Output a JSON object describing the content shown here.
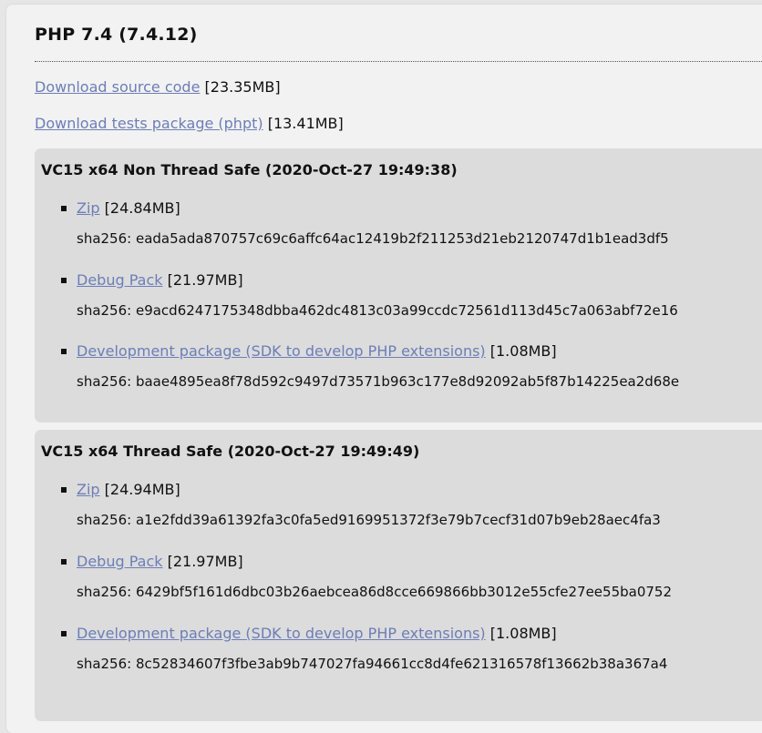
{
  "version": {
    "title": "PHP 7.4 (7.4.12)"
  },
  "downloads": {
    "source": {
      "link": "Download source code",
      "size": "[23.35MB]"
    },
    "tests": {
      "link": "Download tests package (phpt)",
      "size": "[13.41MB]"
    }
  },
  "builds": [
    {
      "title": "VC15 x64 Non Thread Safe (2020-Oct-27 19:49:38)",
      "packages": [
        {
          "link": "Zip",
          "size": "[24.84MB]",
          "sha": "sha256: eada5ada870757c69c6affc64ac12419b2f211253d21eb2120747d1b1ead3df5"
        },
        {
          "link": "Debug Pack",
          "size": "[21.97MB]",
          "sha": "sha256: e9acd6247175348dbba462dc4813c03a99ccdc72561d113d45c7a063abf72e16"
        },
        {
          "link": "Development package (SDK to develop PHP extensions)",
          "size": "[1.08MB]",
          "sha": "sha256: baae4895ea8f78d592c9497d73571b963c177e8d92092ab5f87b14225ea2d68e"
        }
      ]
    },
    {
      "title": "VC15 x64 Thread Safe (2020-Oct-27 19:49:49)",
      "packages": [
        {
          "link": "Zip",
          "size": "[24.94MB]",
          "sha": "sha256: a1e2fdd39a61392fa3c0fa5ed9169951372f3e79b7cecf31d07b9eb28aec4fa3"
        },
        {
          "link": "Debug Pack",
          "size": "[21.97MB]",
          "sha": "sha256: 6429bf5f161d6dbc03b26aebcea86d8cce669866bb3012e55cfe27ee55ba0752"
        },
        {
          "link": "Development package (SDK to develop PHP extensions)",
          "size": "[1.08MB]",
          "sha": "sha256: 8c52834607f3fbe3ab9b747027fa94661cc8d4fe621316578f13662b38a367a4"
        }
      ]
    }
  ],
  "colors": {
    "link": "#6c7eb7",
    "panel_background": "#f2f2f2",
    "build_background": "#dcdcdc"
  }
}
